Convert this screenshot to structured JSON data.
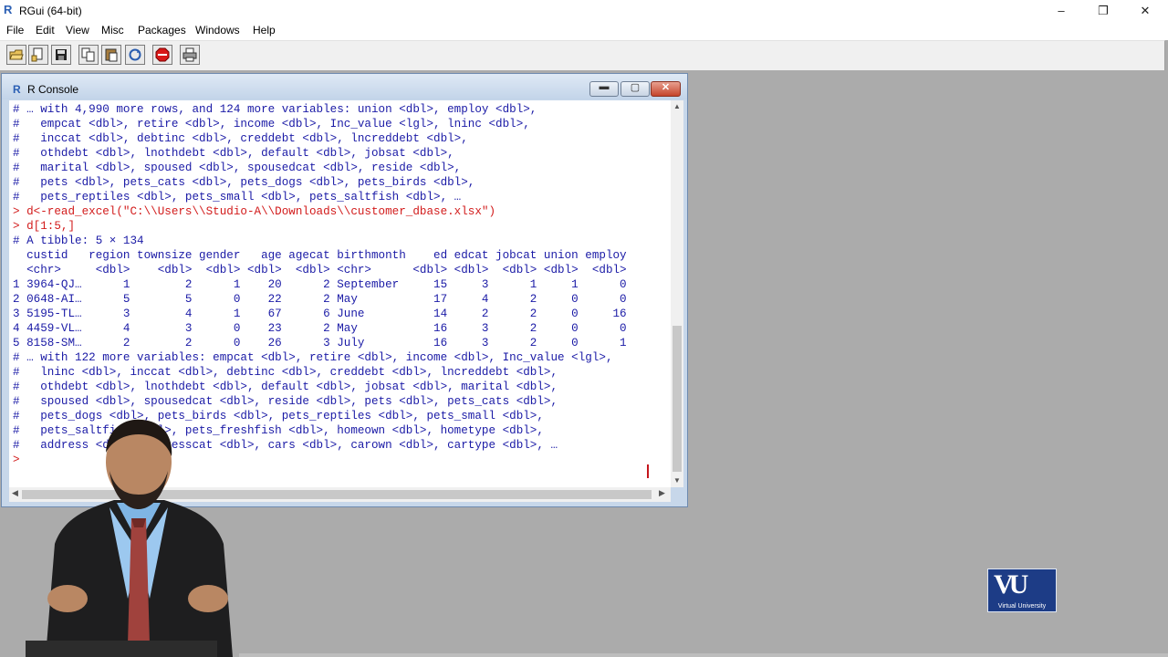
{
  "window": {
    "title": "RGui (64-bit)",
    "controls": [
      "–",
      "❐",
      "✕"
    ]
  },
  "menu": [
    "File",
    "Edit",
    "View",
    "Misc",
    "Packages",
    "Windows",
    "Help"
  ],
  "toolbar": {
    "buttons": [
      "open-script-icon",
      "load-workspace-icon",
      "save-workspace-icon",
      "copy-icon",
      "paste-icon",
      "copy-paste-icon",
      "stop-icon",
      "print-icon"
    ]
  },
  "console": {
    "title": "R Console",
    "lines": [
      {
        "text": "# … with 4,990 more rows, and 124 more variables: union <dbl>, employ <dbl>,",
        "kind": "out"
      },
      {
        "text": "#   empcat <dbl>, retire <dbl>, income <dbl>, Inc_value <lgl>, lninc <dbl>,",
        "kind": "out"
      },
      {
        "text": "#   inccat <dbl>, debtinc <dbl>, creddebt <dbl>, lncreddebt <dbl>,",
        "kind": "out"
      },
      {
        "text": "#   othdebt <dbl>, lnothdebt <dbl>, default <dbl>, jobsat <dbl>,",
        "kind": "out"
      },
      {
        "text": "#   marital <dbl>, spoused <dbl>, spousedcat <dbl>, reside <dbl>,",
        "kind": "out"
      },
      {
        "text": "#   pets <dbl>, pets_cats <dbl>, pets_dogs <dbl>, pets_birds <dbl>,",
        "kind": "out"
      },
      {
        "text": "#   pets_reptiles <dbl>, pets_small <dbl>, pets_saltfish <dbl>, …",
        "kind": "out"
      },
      {
        "text": "> d<-read_excel(\"C:\\\\Users\\\\Studio-A\\\\Downloads\\\\customer_dbase.xlsx\")",
        "kind": "cmd"
      },
      {
        "text": "> d[1:5,]",
        "kind": "cmd"
      },
      {
        "text": "# A tibble: 5 × 134",
        "kind": "out"
      },
      {
        "text": "  custid   region townsize gender   age agecat birthmonth    ed edcat jobcat union employ",
        "kind": "out"
      },
      {
        "text": "  <chr>     <dbl>    <dbl>  <dbl> <dbl>  <dbl> <chr>      <dbl> <dbl>  <dbl> <dbl>  <dbl>",
        "kind": "out"
      },
      {
        "text": "1 3964-QJ…      1        2      1    20      2 September     15     3      1     1      0",
        "kind": "out"
      },
      {
        "text": "2 0648-AI…      5        5      0    22      2 May           17     4      2     0      0",
        "kind": "out"
      },
      {
        "text": "3 5195-TL…      3        4      1    67      6 June          14     2      2     0     16",
        "kind": "out"
      },
      {
        "text": "4 4459-VL…      4        3      0    23      2 May           16     3      2     0      0",
        "kind": "out"
      },
      {
        "text": "5 8158-SM…      2        2      0    26      3 July          16     3      2     0      1",
        "kind": "out"
      },
      {
        "text": "# … with 122 more variables: empcat <dbl>, retire <dbl>, income <dbl>, Inc_value <lgl>,",
        "kind": "out"
      },
      {
        "text": "#   lninc <dbl>, inccat <dbl>, debtinc <dbl>, creddebt <dbl>, lncreddebt <dbl>,",
        "kind": "out"
      },
      {
        "text": "#   othdebt <dbl>, lnothdebt <dbl>, default <dbl>, jobsat <dbl>, marital <dbl>,",
        "kind": "out"
      },
      {
        "text": "#   spoused <dbl>, spousedcat <dbl>, reside <dbl>, pets <dbl>, pets_cats <dbl>,",
        "kind": "out"
      },
      {
        "text": "#   pets_dogs <dbl>, pets_birds <dbl>, pets_reptiles <dbl>, pets_small <dbl>,",
        "kind": "out"
      },
      {
        "text": "#   pets_saltfish <dbl>, pets_freshfish <dbl>, homeown <dbl>, hometype <dbl>,",
        "kind": "out"
      },
      {
        "text": "#   address <dbl>, addresscat <dbl>, cars <dbl>, carown <dbl>, cartype <dbl>, …",
        "kind": "out"
      },
      {
        "text": ">",
        "kind": "cmd"
      }
    ]
  },
  "logo": {
    "mark": "VU",
    "caption": "Virtual University"
  },
  "colors": {
    "command": "#d21b1b",
    "output": "#1a1aa6",
    "desktop": "#ababab",
    "logo": "#1d3c86"
  }
}
